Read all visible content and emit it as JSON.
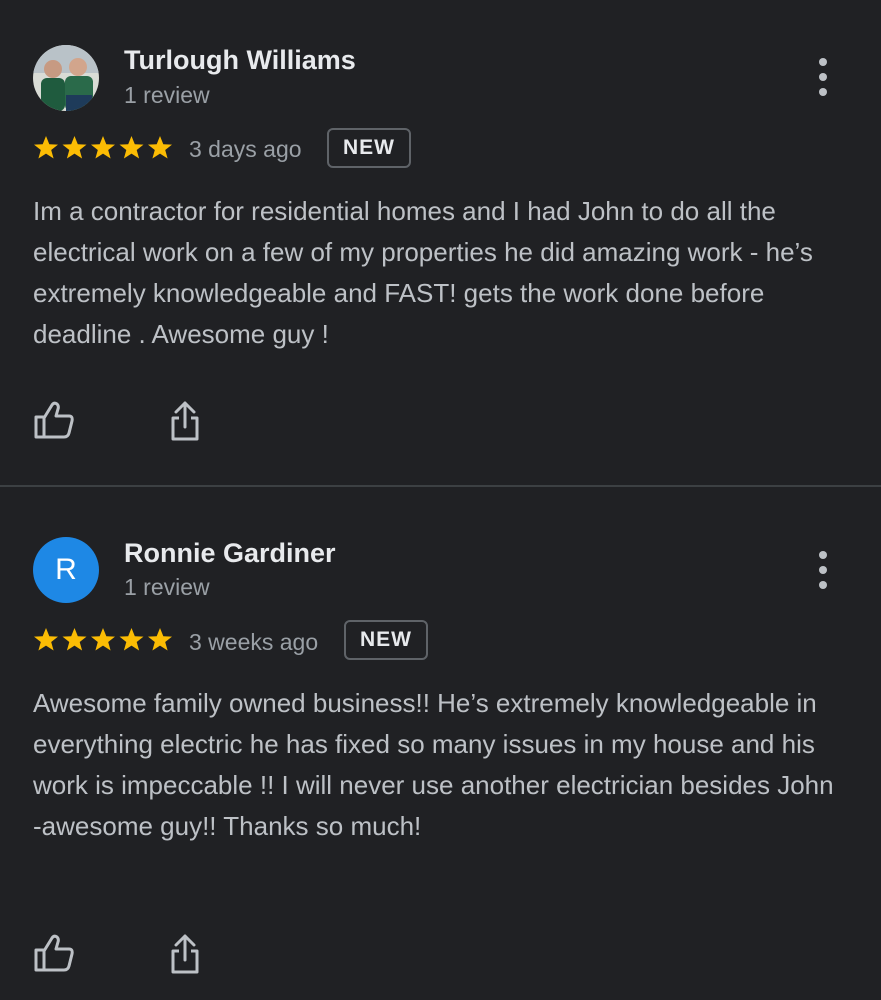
{
  "colors": {
    "background": "#202124",
    "star": "#fbbc04",
    "avatar_letter_bg": "#1e88e5"
  },
  "icons": {
    "like": "thumbs-up-icon",
    "share": "share-icon",
    "menu": "more-vert-icon",
    "star": "star-icon"
  },
  "reviews": [
    {
      "author": "Turlough Williams",
      "review_count": "1 review",
      "rating": 5,
      "time": "3 days ago",
      "badge": "NEW",
      "text": "Im a contractor for residential homes and I had John to do all the electrical work on a few of my properties he did amazing work - he’s extremely knowledgeable and FAST! gets the work done before deadline . Awesome guy !"
    },
    {
      "author": "Ronnie Gardiner",
      "avatar_letter": "R",
      "review_count": "1 review",
      "rating": 5,
      "time": "3 weeks ago",
      "badge": "NEW",
      "text": "Awesome family owned business!! He’s extremely knowledgeable in everything electric he has fixed so many issues in my house and his work is impeccable !! I will never use another electrician besides John -awesome guy!! Thanks so much!"
    }
  ]
}
